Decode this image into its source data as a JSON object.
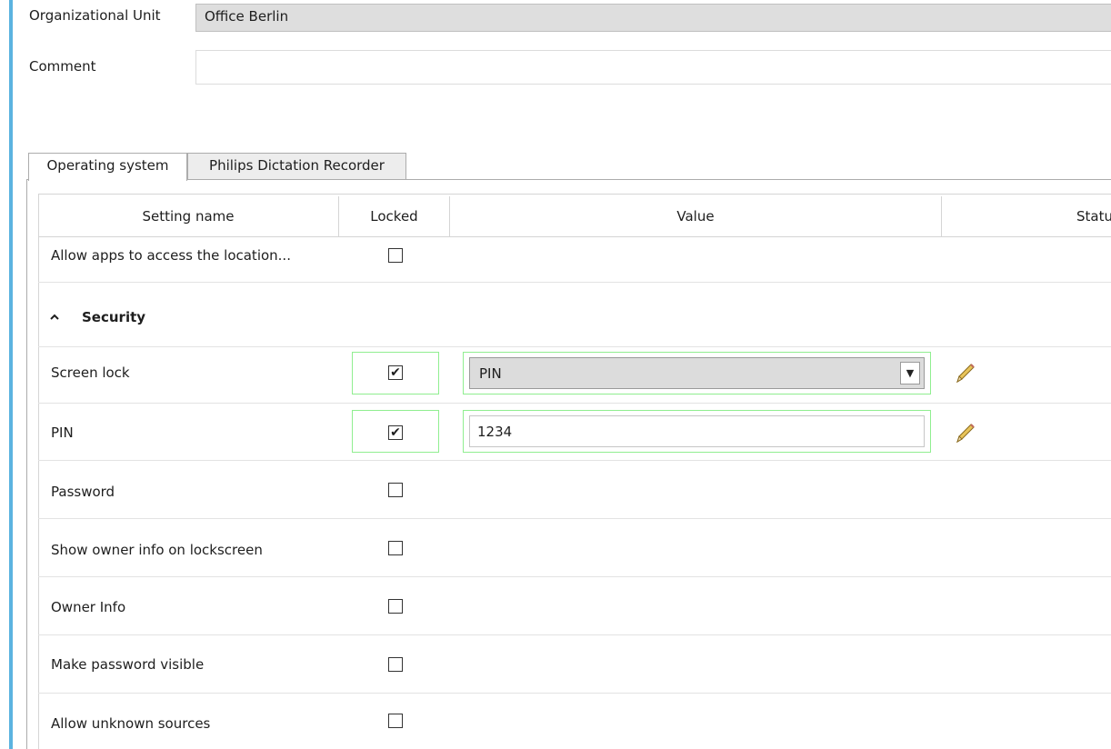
{
  "form": {
    "ou_label": "Organizational Unit",
    "ou_value": "Office Berlin",
    "comment_label": "Comment",
    "comment_value": ""
  },
  "tabs": [
    {
      "label": "Operating system",
      "selected": true
    },
    {
      "label": "Philips Dictation Recorder",
      "selected": false
    }
  ],
  "grid": {
    "columns": {
      "setting_name": "Setting name",
      "locked": "Locked",
      "value": "Value",
      "status": "Status"
    },
    "rows": {
      "location": {
        "name": "Allow apps to access the location...",
        "locked": false
      },
      "security_group": {
        "label": "Security",
        "expanded": true,
        "icon": "chevron-up-icon"
      },
      "screen_lock": {
        "name": "Screen lock",
        "locked": true,
        "value": "PIN"
      },
      "pin": {
        "name": "PIN",
        "locked": true,
        "value": "1234"
      },
      "password": {
        "name": "Password",
        "locked": false
      },
      "show_owner_info": {
        "name": "Show owner info on lockscreen",
        "locked": false
      },
      "owner_info": {
        "name": "Owner Info",
        "locked": false
      },
      "make_password_visible": {
        "name": "Make password visible",
        "locked": false
      },
      "unknown_sources": {
        "name": "Allow unknown sources",
        "locked": false
      }
    },
    "check_mark": "✔",
    "dropdown_arrow": "▼"
  },
  "colors": {
    "accent_bar": "#5bb3e0",
    "locked_highlight": "#90ee90",
    "field_bg": "#dedede"
  }
}
